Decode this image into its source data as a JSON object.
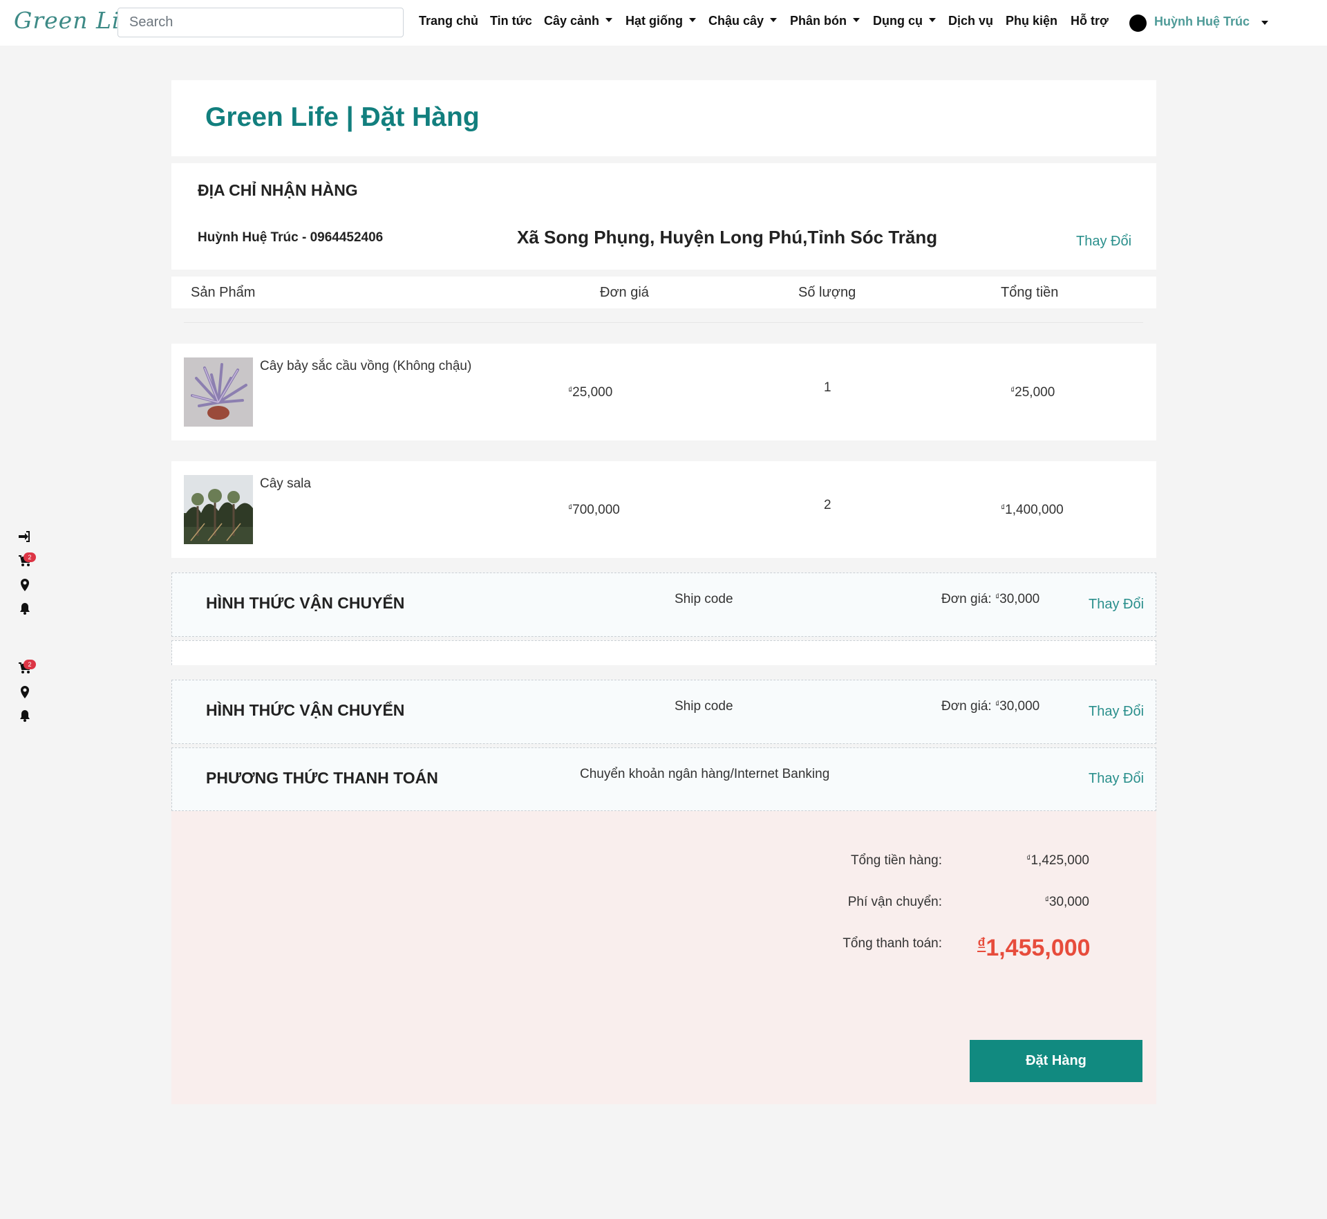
{
  "nav": {
    "brand": "Green Life",
    "search_placeholder": "Search",
    "items": [
      {
        "label": "Trang chủ",
        "dropdown": false
      },
      {
        "label": "Tin tức",
        "dropdown": false
      },
      {
        "label": "Cây cảnh",
        "dropdown": true
      },
      {
        "label": "Hạt giống",
        "dropdown": true
      },
      {
        "label": "Chậu cây",
        "dropdown": true
      },
      {
        "label": "Phân bón",
        "dropdown": true
      },
      {
        "label": "Dụng cụ",
        "dropdown": true
      },
      {
        "label": "Dịch vụ",
        "dropdown": false
      },
      {
        "label": "Phụ kiện",
        "dropdown": false
      },
      {
        "label": "Hỗ trợ",
        "dropdown": false
      }
    ],
    "user": "Huỳnh Huệ Trúc"
  },
  "side": {
    "icons": [
      "sign-in-icon",
      "cart-icon",
      "map-marker-icon",
      "bell-icon",
      "cart-icon",
      "map-marker-icon",
      "bell-icon"
    ],
    "cart_count": "2"
  },
  "page": {
    "title": "Green Life | Đặt Hàng"
  },
  "address": {
    "heading": "ĐỊA CHỈ NHẬN HÀNG",
    "name_phone": "Huỳnh Huệ Trúc - 0964452406",
    "address": "Xã Song Phụng, Huyện Long Phú,Tỉnh Sóc Trăng",
    "change_label": "Thay Đổi"
  },
  "table": {
    "headers": [
      "Sản Phẩm",
      "Đơn giá",
      "Số lượng",
      "Tổng tiền"
    ],
    "rows": [
      {
        "name": "Cây bảy sắc cầu vồng (Không chậu)",
        "price": "25,000",
        "qty": "1",
        "total": "25,000"
      },
      {
        "name": "Cây sala",
        "price": "700,000",
        "qty": "2",
        "total": "1,400,000"
      }
    ],
    "currency": "₫"
  },
  "shipping": {
    "heading": "HÌNH THỨC VẬN CHUYỂN",
    "method": "Ship code",
    "price_label": "Đơn giá:",
    "price": "30,000",
    "change_label": "Thay Đổi"
  },
  "payment": {
    "heading": "PHƯƠNG THỨC THANH TOÁN",
    "method": "Chuyển khoản ngân hàng/Internet Banking",
    "change_label": "Thay Đổi"
  },
  "summary": {
    "goods_label": "Tổng tiền hàng:",
    "goods_value": "1,425,000",
    "ship_label": "Phí vận chuyển:",
    "ship_value": "30,000",
    "total_label": "Tổng thanh toán:",
    "total_value": "1,455,000",
    "order_button": "Đặt Hàng"
  },
  "colors": {
    "brand": "#127f7e",
    "link": "#2a8f8c",
    "total": "#e74c3c",
    "button": "#118a80",
    "summary_bg": "#f9eeed"
  }
}
